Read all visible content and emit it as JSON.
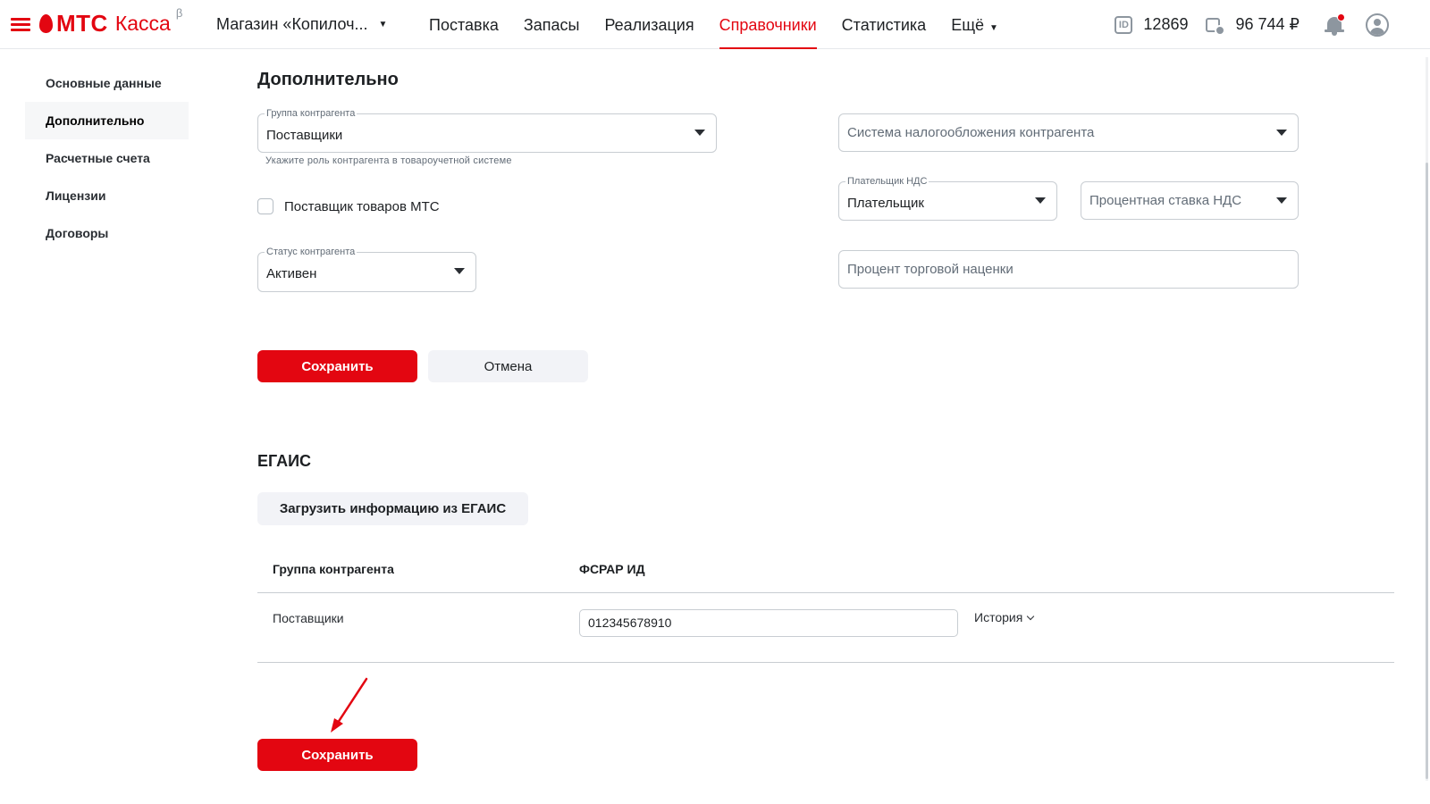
{
  "header": {
    "logo_brand": "МТС",
    "logo_product": "Касса",
    "logo_beta": "β",
    "store_name": "Магазин «Копилоч...",
    "nav": [
      {
        "label": "Поставка"
      },
      {
        "label": "Запасы"
      },
      {
        "label": "Реализация"
      },
      {
        "label": "Справочники",
        "active": true
      },
      {
        "label": "Статистика"
      },
      {
        "label": "Ещё"
      }
    ],
    "id_icon_text": "ID",
    "id_value": "12869",
    "balance": "96 744 ₽",
    "accent_color": "#e30611"
  },
  "sidebar": {
    "items": [
      {
        "label": "Основные данные"
      },
      {
        "label": "Дополнительно",
        "active": true
      },
      {
        "label": "Расчетные счета"
      },
      {
        "label": "Лицензии"
      },
      {
        "label": "Договоры"
      }
    ]
  },
  "form": {
    "title": "Дополнительно",
    "group": {
      "label": "Группа контрагента",
      "value": "Поставщики",
      "hint": "Укажите роль контрагента в товароучетной системе"
    },
    "mts_supplier": {
      "label": "Поставщик товаров МТС",
      "checked": false
    },
    "status": {
      "label": "Статус контрагента",
      "value": "Активен"
    },
    "tax_system": {
      "placeholder": "Система налогообложения контрагента"
    },
    "vat_payer": {
      "label": "Плательщик НДС",
      "value": "Плательщик"
    },
    "vat_rate": {
      "placeholder": "Процентная ставка НДС"
    },
    "markup": {
      "placeholder": "Процент торговой наценки"
    },
    "save_label": "Сохранить",
    "cancel_label": "Отмена"
  },
  "egais": {
    "title": "ЕГАИС",
    "load_button": "Загрузить информацию из ЕГАИС",
    "columns": [
      "Группа контрагента",
      "ФСРАР ИД"
    ],
    "rows": [
      {
        "group": "Поставщики",
        "fsrar_id": "012345678910",
        "history_label": "История"
      }
    ],
    "save_label": "Сохранить"
  },
  "icons": {
    "menu": "menu-icon",
    "id": "id-icon",
    "wallet": "wallet-icon",
    "notifications": "bell-icon",
    "profile": "user-icon"
  }
}
